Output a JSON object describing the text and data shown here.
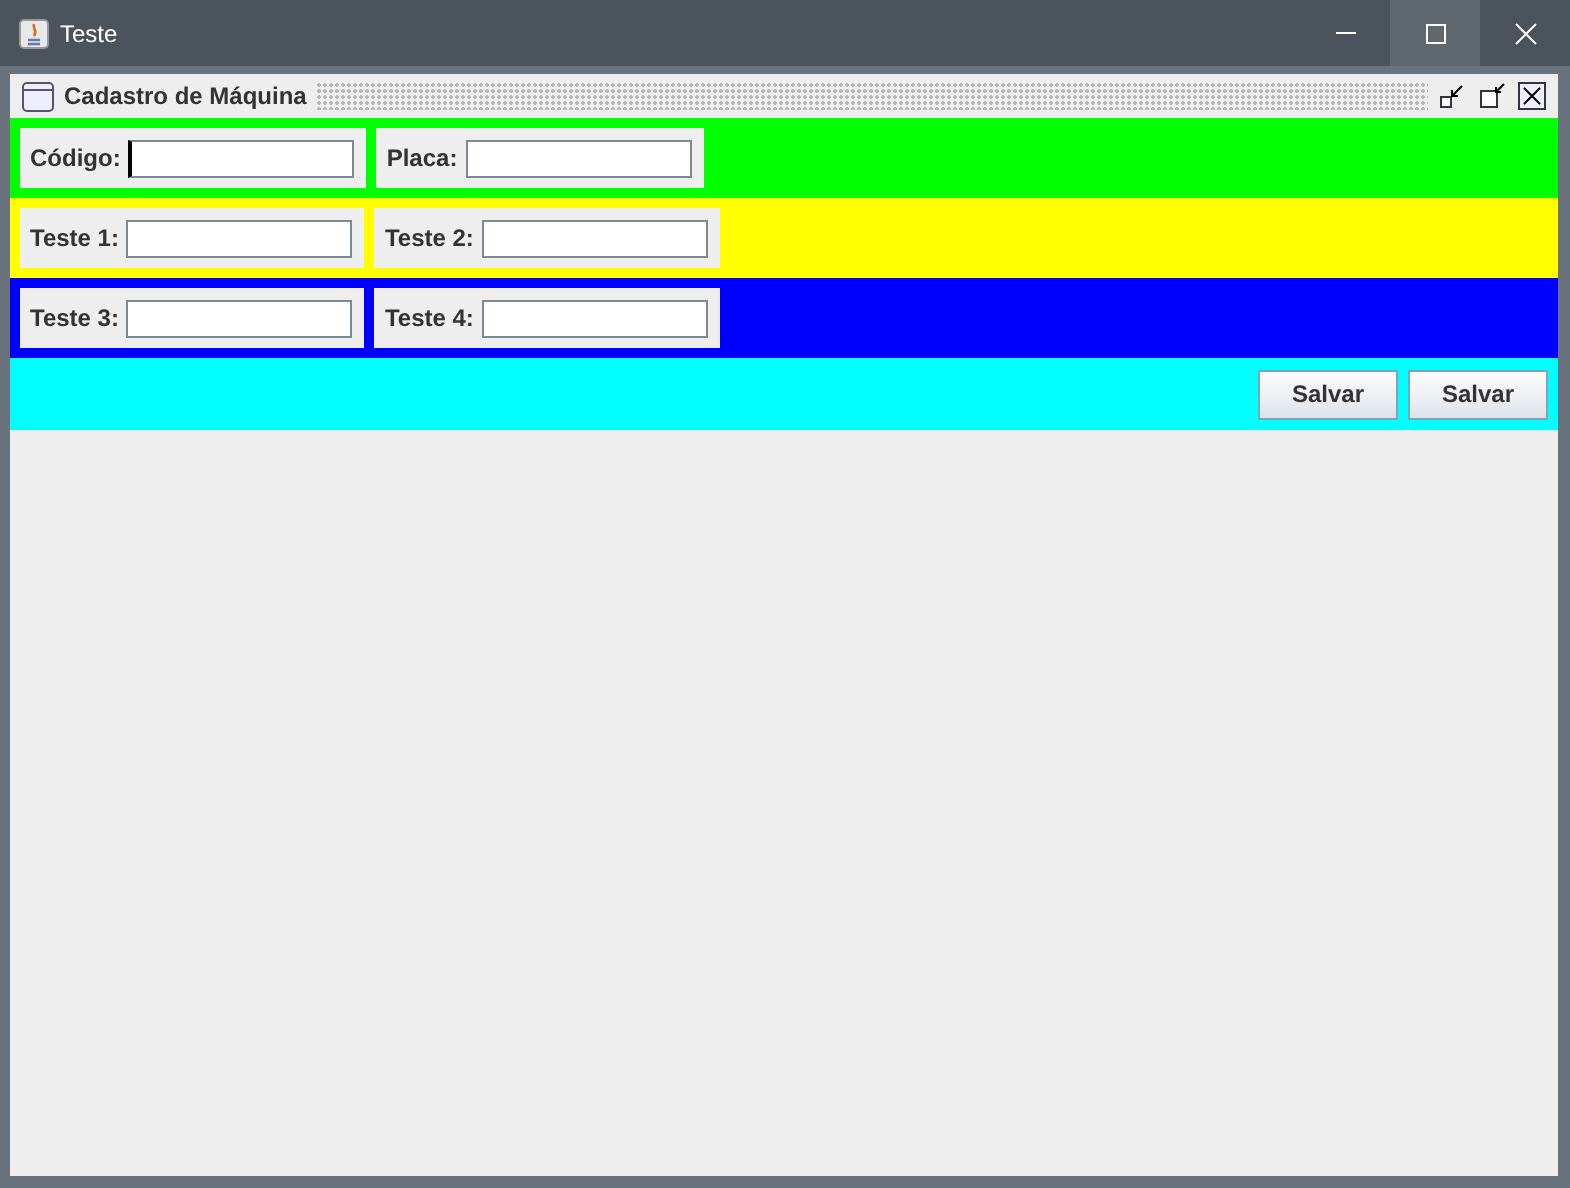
{
  "window": {
    "title": "Teste"
  },
  "internal_frame": {
    "title": "Cadastro de Máquina"
  },
  "rows": [
    {
      "color": "#00ff00",
      "fields": [
        {
          "label": "Código:",
          "focused": true
        },
        {
          "label": "Placa:",
          "focused": false
        }
      ]
    },
    {
      "color": "#ffff00",
      "fields": [
        {
          "label": "Teste 1:",
          "focused": false
        },
        {
          "label": "Teste 2:",
          "focused": false
        }
      ]
    },
    {
      "color": "#0000ff",
      "fields": [
        {
          "label": "Teste 3:",
          "focused": false
        },
        {
          "label": "Teste 4:",
          "focused": false
        }
      ]
    }
  ],
  "button_bar": {
    "color": "#00ffff",
    "buttons": [
      "Salvar",
      "Salvar"
    ]
  }
}
